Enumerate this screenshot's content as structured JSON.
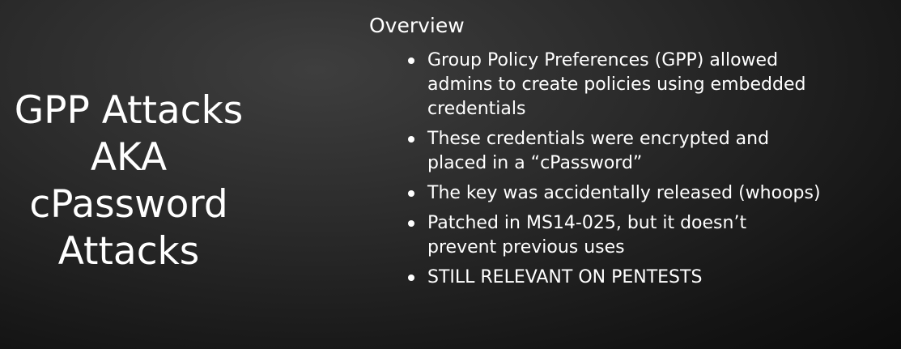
{
  "slide": {
    "title_lines": [
      "GPP Attacks",
      "AKA",
      "cPassword",
      "Attacks"
    ],
    "heading": "Overview",
    "bullets": [
      {
        "lines": [
          "Group Policy Preferences (GPP) allowed",
          "admins to create policies using embedded",
          "credentials"
        ]
      },
      {
        "lines": [
          "These credentials were encrypted and",
          "placed in a “cPassword”"
        ]
      },
      {
        "lines": [
          "The key was accidentally released (whoops)"
        ]
      },
      {
        "lines": [
          "Patched in MS14-025, but it doesn’t",
          "prevent previous uses"
        ]
      },
      {
        "lines": [
          "STILL RELEVANT ON PENTESTS"
        ]
      }
    ]
  },
  "colors": {
    "background": "#1e1e1e",
    "text": "#ffffff"
  }
}
